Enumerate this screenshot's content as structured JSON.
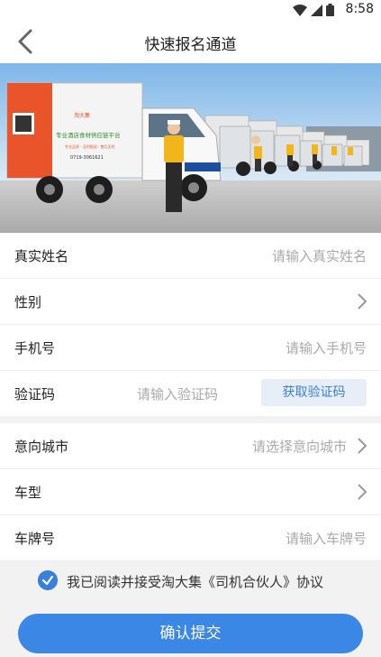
{
  "status": {
    "time": "8:58"
  },
  "header": {
    "title": "快速报名通道"
  },
  "banner": {
    "truck_brand": "淘大集",
    "truck_slogan": "专业酒店食材供应链平台",
    "truck_tags": "专业品质 · 及时配送 · 售后无忧",
    "truck_phone": "0719-3061621"
  },
  "form": {
    "name": {
      "label": "真实姓名",
      "placeholder": "请输入真实姓名"
    },
    "gender": {
      "label": "性别"
    },
    "phone": {
      "label": "手机号",
      "placeholder": "请输入手机号"
    },
    "code": {
      "label": "验证码",
      "placeholder": "请输入验证码",
      "button": "获取验证码"
    },
    "city": {
      "label": "意向城市",
      "placeholder": "请选择意向城市"
    },
    "vehicle": {
      "label": "车型"
    },
    "plate": {
      "label": "车牌号",
      "placeholder": "请输入车牌号"
    }
  },
  "agreement": {
    "text": "我已阅读并接受淘大集《司机合伙人》协议",
    "checked": true
  },
  "submit": {
    "label": "确认提交"
  },
  "colors": {
    "accent": "#3a87e6"
  }
}
